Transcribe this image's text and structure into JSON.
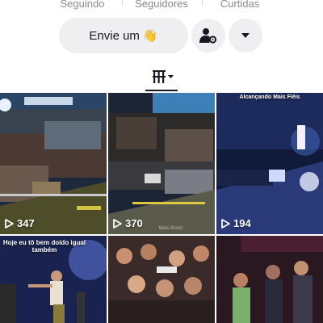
{
  "profile_stats": {
    "following_label": "Seguindo",
    "followers_label": "Seguidores",
    "likes_label": "Curtidas"
  },
  "actions": {
    "message_button": "Envie um",
    "message_emoji": "👋",
    "follow_suggest_icon": "person-gear-icon",
    "more_icon": "caret-down-icon"
  },
  "tabs": {
    "active_tab_icon": "grid-icon"
  },
  "videos": [
    {
      "views": "347",
      "overlay": ""
    },
    {
      "views": "370",
      "overlay": "",
      "watermark": "Mais Brasil"
    },
    {
      "views": "194",
      "overlay": "Alcançando Mais Fiéis"
    },
    {
      "views": "",
      "overlay": "Hoje eu tô bem doido igual também"
    },
    {
      "views": "",
      "overlay": ""
    },
    {
      "views": "",
      "overlay": ""
    }
  ],
  "colors": {
    "text_primary": "#161823",
    "text_secondary": "#8a8b91",
    "button_bg": "#efeff1"
  }
}
